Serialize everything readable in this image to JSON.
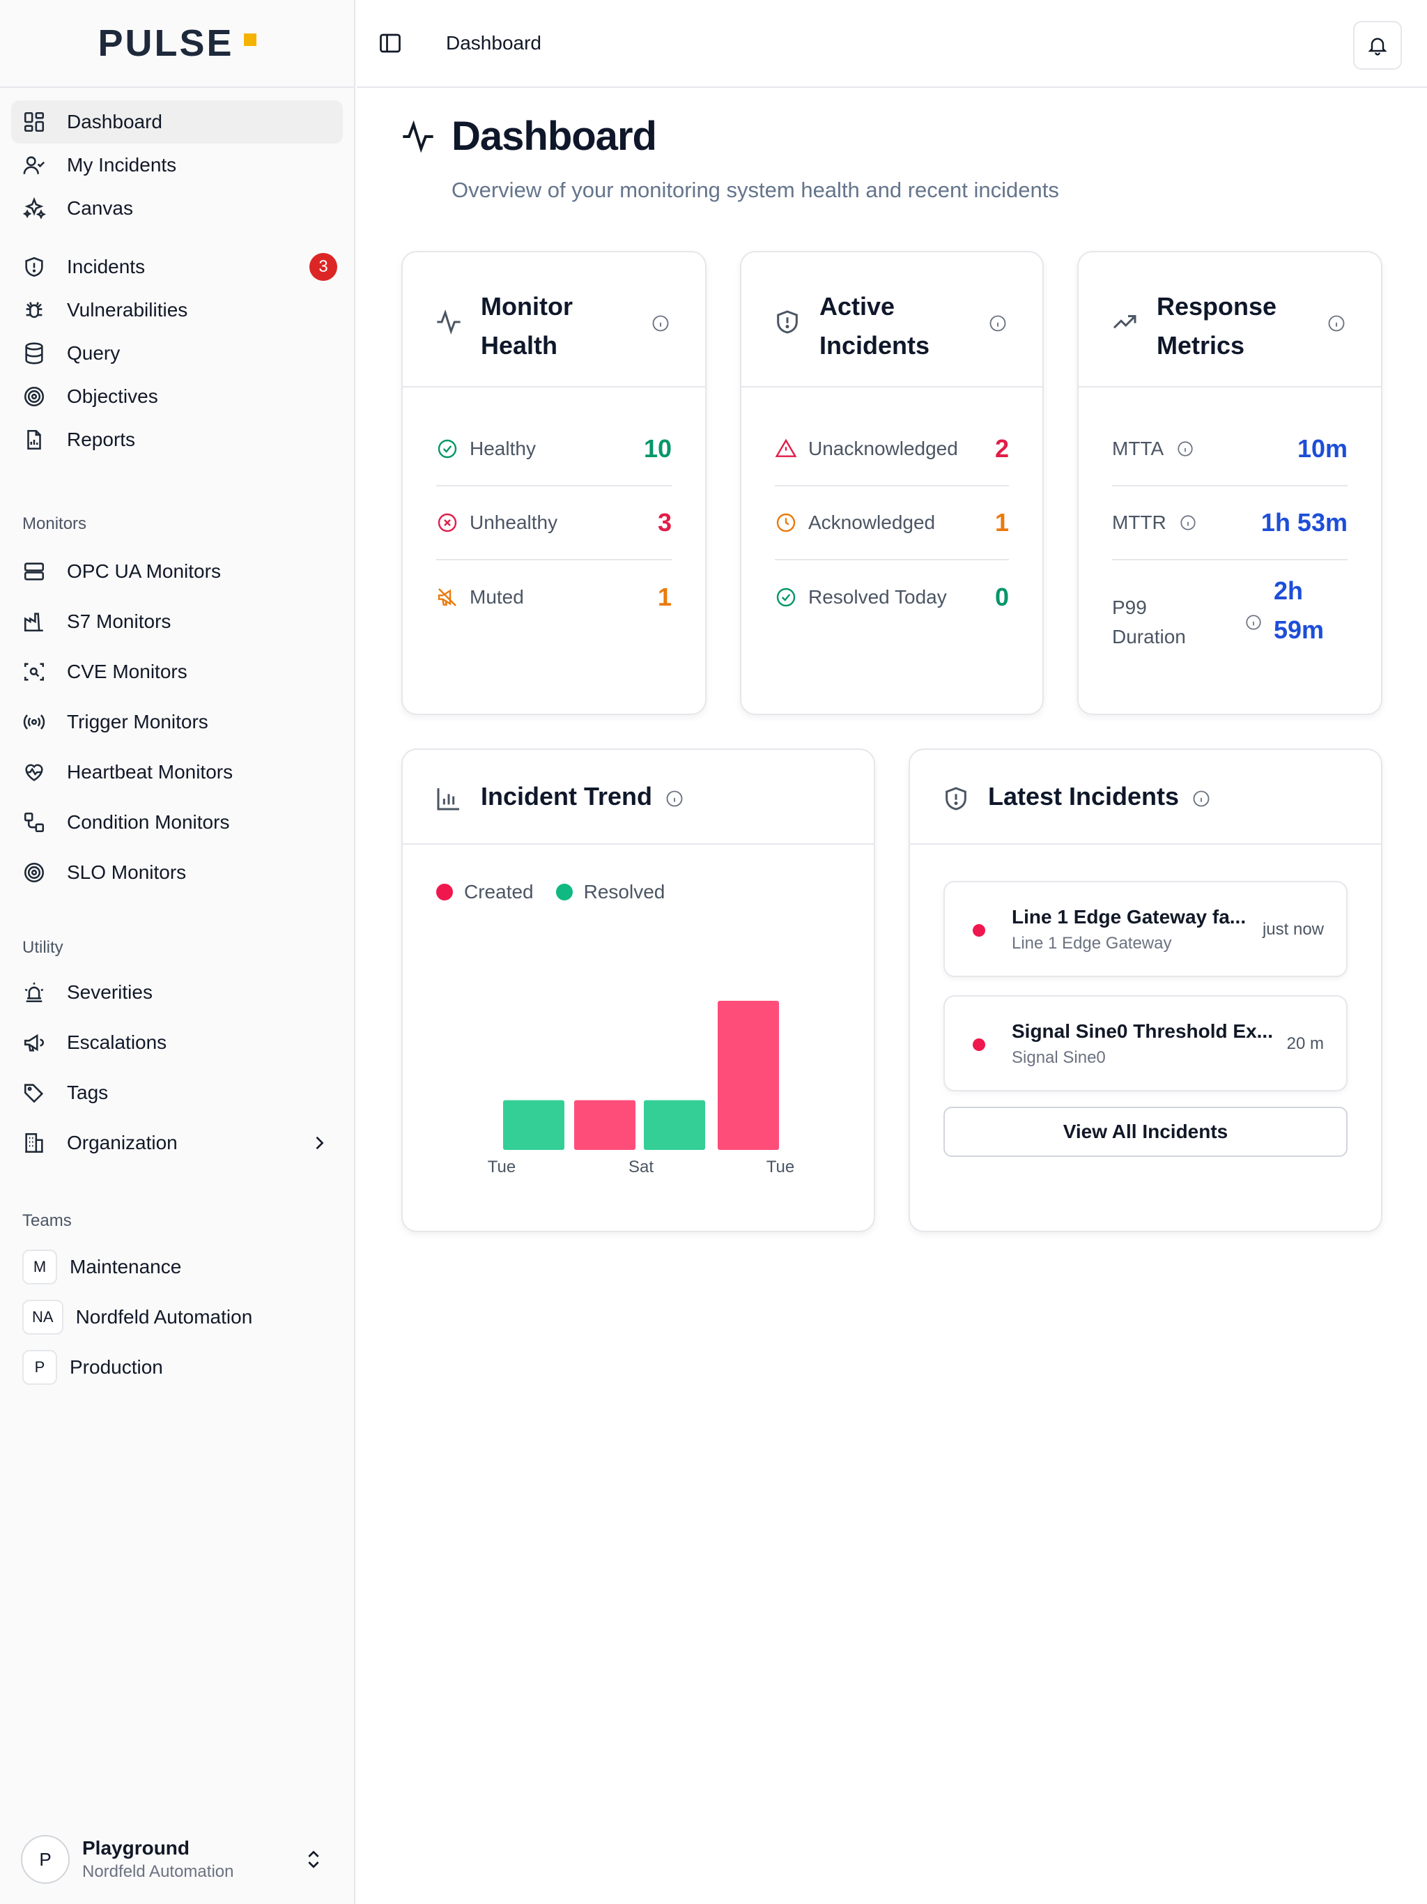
{
  "app": {
    "brand": "PULSE",
    "brand_accent": "#f5b301"
  },
  "sidebar": {
    "main_items": [
      {
        "label": "Dashboard",
        "icon": "layout-dashboard-icon",
        "active": true
      },
      {
        "label": "My Incidents",
        "icon": "user-icon"
      },
      {
        "label": "Canvas",
        "icon": "sparkles-icon"
      },
      {
        "label": "Incidents",
        "icon": "shield-alert-icon",
        "badge": "3"
      },
      {
        "label": "Vulnerabilities",
        "icon": "bug-icon"
      },
      {
        "label": "Query",
        "icon": "database-icon"
      },
      {
        "label": "Objectives",
        "icon": "target-icon"
      },
      {
        "label": "Reports",
        "icon": "file-chart-icon"
      }
    ],
    "monitors_label": "Monitors",
    "monitors": [
      {
        "label": "OPC UA Monitors",
        "icon": "server-icon"
      },
      {
        "label": "S7 Monitors",
        "icon": "factory-icon"
      },
      {
        "label": "CVE Monitors",
        "icon": "scan-search-icon"
      },
      {
        "label": "Trigger Monitors",
        "icon": "radio-icon"
      },
      {
        "label": "Heartbeat Monitors",
        "icon": "heart-pulse-icon"
      },
      {
        "label": "Condition Monitors",
        "icon": "workflow-icon"
      },
      {
        "label": "SLO Monitors",
        "icon": "target-icon"
      }
    ],
    "utility_label": "Utility",
    "utility": [
      {
        "label": "Severities",
        "icon": "siren-icon"
      },
      {
        "label": "Escalations",
        "icon": "megaphone-icon"
      },
      {
        "label": "Tags",
        "icon": "tags-icon"
      },
      {
        "label": "Organization",
        "icon": "building-icon"
      }
    ],
    "teams_label": "Teams",
    "teams": [
      {
        "initials": "M",
        "label": "Maintenance"
      },
      {
        "initials": "NA",
        "label": "Nordfeld Automation"
      },
      {
        "initials": "P",
        "label": "Production"
      }
    ],
    "account": {
      "initial": "P",
      "name": "Playground",
      "org": "Nordfeld Automation"
    }
  },
  "topbar": {
    "breadcrumb": "Dashboard"
  },
  "header": {
    "title": "Dashboard",
    "subtitle": "Overview of your monitoring system health and recent incidents"
  },
  "monitor_health": {
    "title": "Monitor Health",
    "rows": [
      {
        "label": "Healthy",
        "value": "10"
      },
      {
        "label": "Unhealthy",
        "value": "3"
      },
      {
        "label": "Muted",
        "value": "1"
      }
    ]
  },
  "active_incidents": {
    "title": "Active Incidents",
    "rows": [
      {
        "label": "Unacknowledged",
        "value": "2"
      },
      {
        "label": "Acknowledged",
        "value": "1"
      },
      {
        "label": "Resolved Today",
        "value": "0"
      }
    ]
  },
  "response_metrics": {
    "title": "Response Metrics",
    "rows": [
      {
        "label": "MTTA",
        "value": "10m"
      },
      {
        "label": "MTTR",
        "value": "1h 53m"
      },
      {
        "label_line1": "P99",
        "label_line2": "Duration",
        "value_line1": "2h",
        "value_line2": "59m"
      }
    ]
  },
  "incident_trend": {
    "title": "Incident Trend",
    "legend": {
      "created": "Created",
      "resolved": "Resolved"
    }
  },
  "chart_data": {
    "type": "bar",
    "categories": [
      "Tue",
      "Sat",
      "Tue"
    ],
    "series": [
      {
        "name": "Created",
        "color": "#ff4d7a"
      },
      {
        "name": "Resolved",
        "color": "#34cf96"
      }
    ],
    "bars": [
      {
        "series": "Resolved",
        "value": 1,
        "color": "#34cf96"
      },
      {
        "series": "Created",
        "value": 1,
        "color": "#ff4d7a"
      },
      {
        "series": "Resolved",
        "value": 1,
        "color": "#34cf96"
      },
      {
        "series": "Created",
        "value": 3,
        "color": "#ff4d7a"
      }
    ],
    "ymax": 3,
    "xlabels": [
      "Tue",
      "Sat",
      "Tue"
    ]
  },
  "latest_incidents": {
    "title": "Latest Incidents",
    "items": [
      {
        "title": "Line 1 Edge Gateway fa...",
        "source": "Line 1 Edge Gateway",
        "time": "just now"
      },
      {
        "title": "Signal Sine0 Threshold Ex...",
        "source": "Signal Sine0",
        "time": "20 m"
      }
    ],
    "view_all": "View All Incidents"
  }
}
